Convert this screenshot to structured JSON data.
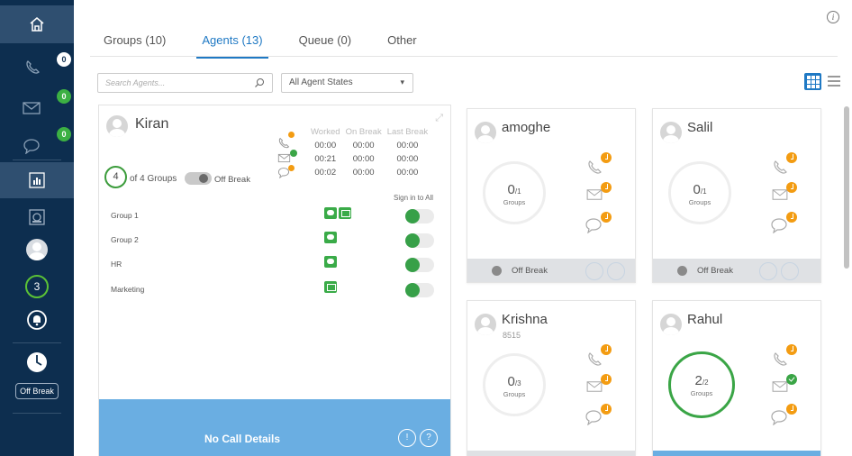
{
  "rail": {
    "call_badge": "0",
    "email_badge": "0",
    "chat_badge": "0",
    "agents_online": "3",
    "status_label": "Off Break"
  },
  "tabs": [
    {
      "label": "Groups (10)",
      "active": false
    },
    {
      "label": "Agents (13)",
      "active": true
    },
    {
      "label": "Queue (0)",
      "active": false
    },
    {
      "label": "Other",
      "active": false
    }
  ],
  "toolbar": {
    "search_placeholder": "Search Agents...",
    "state_filter": "All Agent States"
  },
  "focused_agent": {
    "name": "Kiran",
    "stats_headers": [
      "Worked",
      "On Break",
      "Last Break"
    ],
    "stats": [
      {
        "channel": "call",
        "worked": "00:00",
        "on_break": "00:00",
        "last_break": "00:00"
      },
      {
        "channel": "email",
        "worked": "00:21",
        "on_break": "00:00",
        "last_break": "00:00"
      },
      {
        "channel": "chat",
        "worked": "00:02",
        "on_break": "00:00",
        "last_break": "00:00"
      }
    ],
    "groups_count": "4",
    "groups_text": "of 4 Groups",
    "break_label": "Off Break",
    "sign_in_all": "Sign in to All",
    "groups": [
      {
        "name": "Group 1",
        "channels": [
          "chat",
          "email"
        ],
        "signed_in": true
      },
      {
        "name": "Group 2",
        "channels": [
          "chat"
        ],
        "signed_in": true
      },
      {
        "name": "HR",
        "channels": [
          "chat"
        ],
        "signed_in": true
      },
      {
        "name": "Marketing",
        "channels": [
          "email"
        ],
        "signed_in": true
      }
    ],
    "footer_text": "No Call Details"
  },
  "agents": [
    {
      "name": "amoghe",
      "ext": "",
      "groups_in": "0",
      "groups_total": "1",
      "groups_label": "Groups",
      "break_label": "Off Break",
      "email_state": "idle",
      "active": false
    },
    {
      "name": "Salil",
      "ext": "",
      "groups_in": "0",
      "groups_total": "1",
      "groups_label": "Groups",
      "break_label": "Off Break",
      "email_state": "idle",
      "active": false
    },
    {
      "name": "Krishna",
      "ext": "8515",
      "groups_in": "0",
      "groups_total": "3",
      "groups_label": "Groups",
      "break_label": "",
      "email_state": "idle",
      "active": false
    },
    {
      "name": "Rahul",
      "ext": "",
      "groups_in": "2",
      "groups_total": "2",
      "groups_label": "Groups",
      "break_label": "",
      "email_state": "active",
      "active": true
    }
  ],
  "colors": {
    "rail_bg": "#0d2e4f",
    "accent_blue": "#1f79c4",
    "footer_blue": "#6aaee2",
    "status_green": "#3aa546",
    "status_orange": "#f39c12"
  }
}
